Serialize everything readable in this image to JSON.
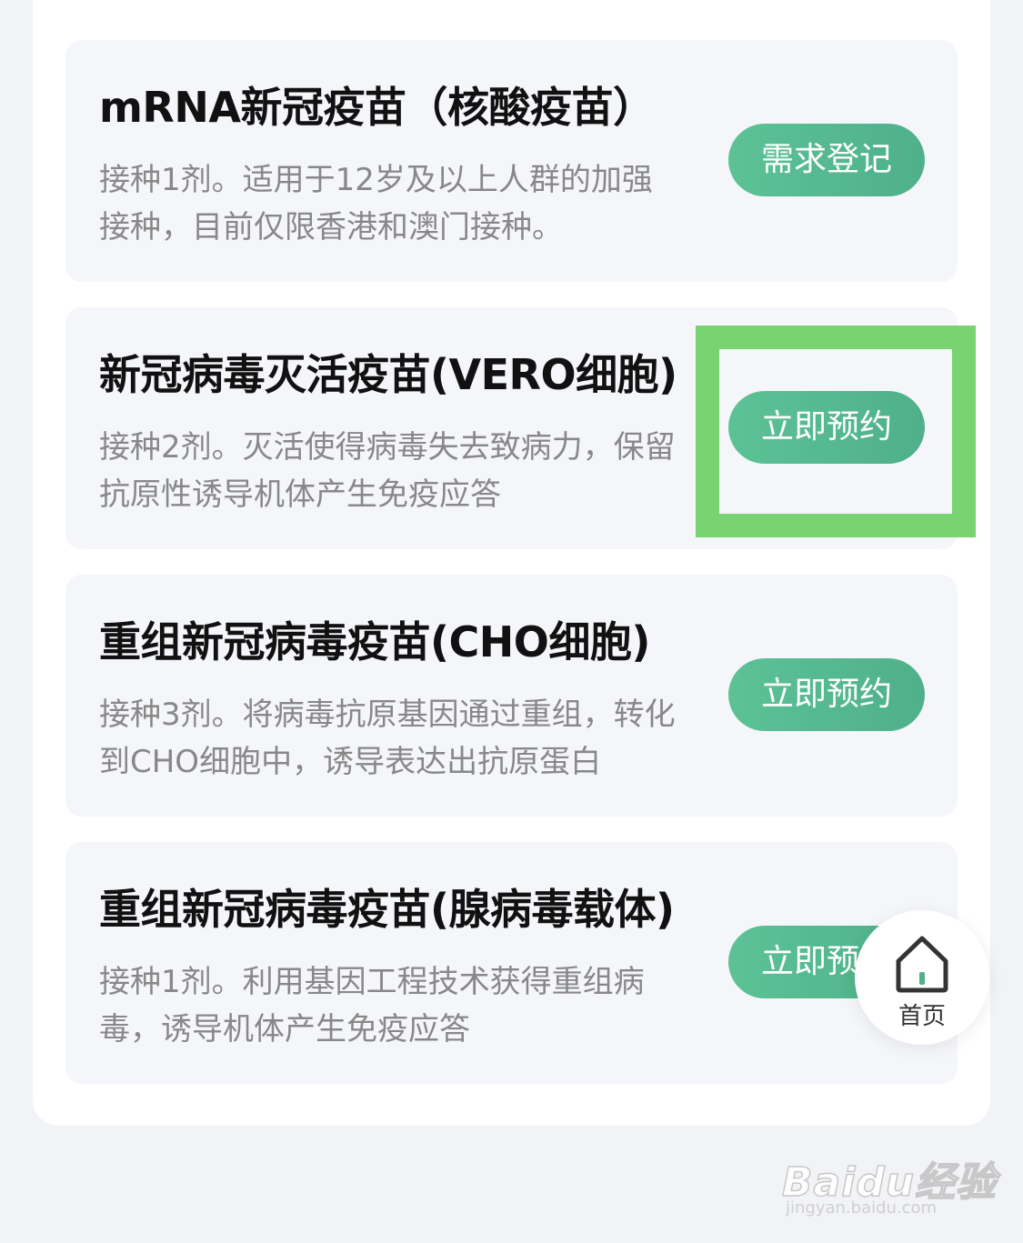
{
  "vaccines": [
    {
      "title": "mRNA新冠疫苗（核酸疫苗）",
      "description": "接种1剂。适用于12岁及以上人群的加强接种，目前仅限香港和澳门接种。",
      "button_label": "需求登记"
    },
    {
      "title": "新冠病毒灭活疫苗(VERO细胞)",
      "description": "接种2剂。灭活使得病毒失去致病力，保留抗原性诱导机体产生免疫应答",
      "button_label": "立即预约"
    },
    {
      "title": "重组新冠病毒疫苗(CHO细胞)",
      "description": "接种3剂。将病毒抗原基因通过重组，转化到CHO细胞中，诱导表达出抗原蛋白",
      "button_label": "立即预约"
    },
    {
      "title": "重组新冠病毒疫苗(腺病毒载体)",
      "description": "接种1剂。利用基因工程技术获得重组病毒，诱导机体产生免疫应答",
      "button_label": "立即预约"
    }
  ],
  "home_button": {
    "label": "首页",
    "icon": "home-icon"
  },
  "watermark": {
    "logo_text": "Baidu经验",
    "url": "jingyan.baidu.com"
  },
  "colors": {
    "button_green": "#5cc296",
    "highlight_green": "#78d470",
    "card_bg": "#f5f6fa",
    "page_bg": "#f2f3f7"
  }
}
